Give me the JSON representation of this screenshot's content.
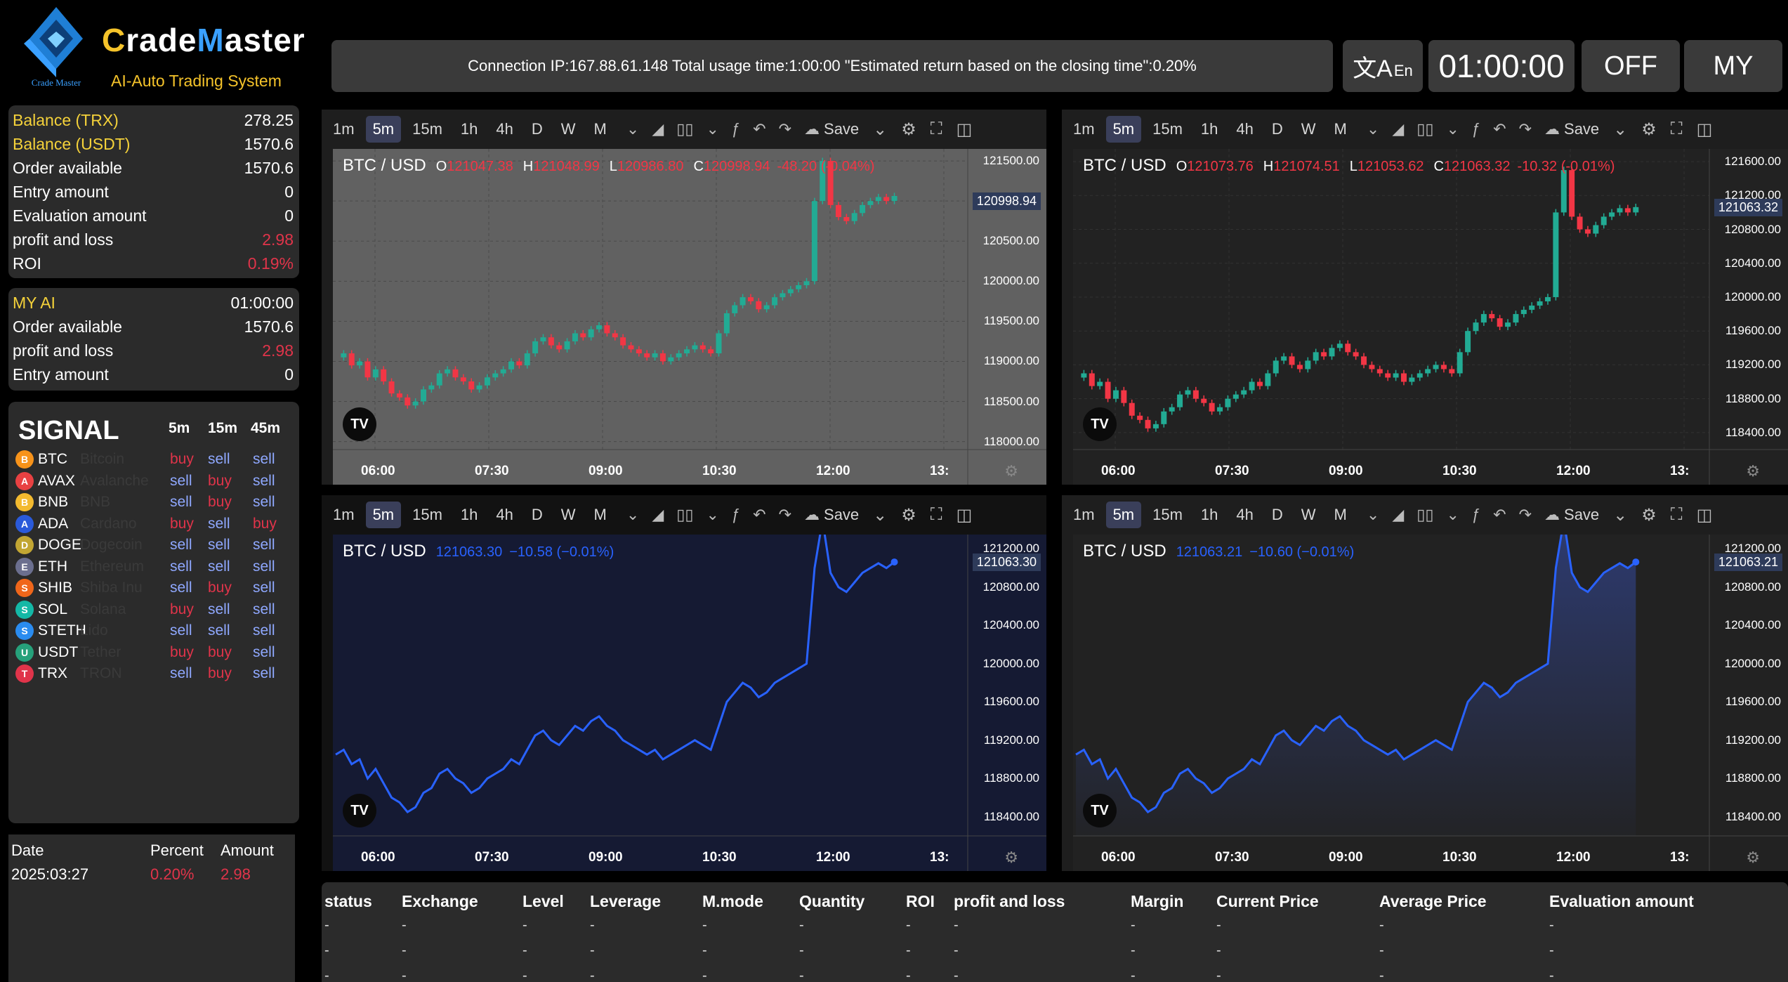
{
  "brand": {
    "part1": "C",
    "part2": "rade",
    "part3": "M",
    "part4": "aster",
    "tagline": "AI-Auto Trading System",
    "logo_caption": "Crade Master"
  },
  "account": {
    "rows": [
      {
        "label": "Balance (TRX)",
        "value": "278.25"
      },
      {
        "label": "Balance (USDT)",
        "value": "1570.6"
      },
      {
        "label": "Order available",
        "value": "1570.6"
      },
      {
        "label": "Entry amount",
        "value": "0"
      },
      {
        "label": "Evaluation amount",
        "value": "0"
      },
      {
        "label": "profit and loss",
        "value": "2.98"
      },
      {
        "label": "ROI",
        "value": "0.19%"
      }
    ]
  },
  "my_ai": {
    "rows": [
      {
        "label": "MY AI",
        "value": "01:00:00"
      },
      {
        "label": "Order available",
        "value": "1570.6"
      },
      {
        "label": "profit and loss",
        "value": "2.98"
      },
      {
        "label": "Entry amount",
        "value": "0"
      }
    ]
  },
  "signal": {
    "title": "SIGNAL",
    "headers": [
      "5m",
      "15m",
      "45m"
    ],
    "rows": [
      {
        "sym": "BTC",
        "name": "Bitcoin",
        "s5": "buy",
        "s15": "sell",
        "s45": "sell",
        "color": "#f7931a"
      },
      {
        "sym": "AVAX",
        "name": "Avalanche",
        "s5": "sell",
        "s15": "buy",
        "s45": "sell",
        "color": "#e84142"
      },
      {
        "sym": "BNB",
        "name": "BNB",
        "s5": "sell",
        "s15": "buy",
        "s45": "sell",
        "color": "#f3ba2f"
      },
      {
        "sym": "ADA",
        "name": "Cardano",
        "s5": "buy",
        "s15": "sell",
        "s45": "buy",
        "color": "#2a5ada"
      },
      {
        "sym": "DOGE",
        "name": "Dogecoin",
        "s5": "sell",
        "s15": "sell",
        "s45": "sell",
        "color": "#c2a633"
      },
      {
        "sym": "ETH",
        "name": "Ethereum",
        "s5": "sell",
        "s15": "sell",
        "s45": "sell",
        "color": "#6b6f8f"
      },
      {
        "sym": "SHIB",
        "name": "Shiba Inu",
        "s5": "sell",
        "s15": "buy",
        "s45": "sell",
        "color": "#f0661a"
      },
      {
        "sym": "SOL",
        "name": "Solana",
        "s5": "buy",
        "s15": "sell",
        "s45": "sell",
        "color": "#14b8a6"
      },
      {
        "sym": "STETH",
        "name": "Lido",
        "s5": "sell",
        "s15": "sell",
        "s45": "sell",
        "color": "#2a8cf0"
      },
      {
        "sym": "USDT",
        "name": "Tether",
        "s5": "buy",
        "s15": "buy",
        "s45": "sell",
        "color": "#26a17b"
      },
      {
        "sym": "TRX",
        "name": "TRON",
        "s5": "sell",
        "s15": "buy",
        "s45": "sell",
        "color": "#e0344a"
      }
    ]
  },
  "history": {
    "headers": [
      "Date",
      "Percent",
      "Amount"
    ],
    "rows": [
      {
        "date": "2025:03:27",
        "percent": "0.20%",
        "amount": "2.98"
      }
    ]
  },
  "topbar": {
    "info": "Connection IP:167.88.61.148 Total usage time:1:00:00 \"Estimated return based on the closing time\":0.20%",
    "lang": "En",
    "lang_icon": "文A",
    "timer": "01:00:00",
    "off": "OFF",
    "my": "MY"
  },
  "toolbar": {
    "timeframes": [
      "1m",
      "5m",
      "15m",
      "1h",
      "4h",
      "D",
      "W",
      "M"
    ],
    "save": "Save",
    "active_tf": "5m"
  },
  "charts": [
    {
      "id": "c1",
      "style": "candles",
      "bg": "#616161",
      "symbol": "BTC / USD",
      "o": "121047.38",
      "h": "121048.99",
      "l": "120986.80",
      "c": "120998.94",
      "chg": "-48.20 (-0.04%)",
      "last": "120998.94",
      "yticks": [
        "121500.00",
        "121000.00",
        "120500.00",
        "120000.00",
        "119500.00",
        "119000.00",
        "118500.00",
        "118000.00"
      ],
      "ymin": 117900,
      "ymax": 121650,
      "xticks": [
        "06:00",
        "07:30",
        "09:00",
        "10:30",
        "12:00",
        "13:"
      ]
    },
    {
      "id": "c2",
      "style": "candles",
      "bg": "#222222",
      "symbol": "BTC / USD",
      "o": "121073.76",
      "h": "121074.51",
      "l": "121053.62",
      "c": "121063.32",
      "chg": "-10.32 (-0.01%)",
      "last": "121063.32",
      "yticks": [
        "121600.00",
        "121200.00",
        "120800.00",
        "120400.00",
        "120000.00",
        "119600.00",
        "119200.00",
        "118800.00",
        "118400.00"
      ],
      "ymin": 118200,
      "ymax": 121750,
      "xticks": [
        "06:00",
        "07:30",
        "09:00",
        "10:30",
        "12:00",
        "13:"
      ]
    },
    {
      "id": "c3",
      "style": "line",
      "bg": "#151a33",
      "symbol": "BTC / USD",
      "val": "121063.30",
      "chg": "−10.58 (−0.01%)",
      "last": "121063.30",
      "yticks": [
        "121200.00",
        "120800.00",
        "120400.00",
        "120000.00",
        "119600.00",
        "119200.00",
        "118800.00",
        "118400.00"
      ],
      "ymin": 118200,
      "ymax": 121350,
      "xticks": [
        "06:00",
        "07:30",
        "09:00",
        "10:30",
        "12:00",
        "13:"
      ]
    },
    {
      "id": "c4",
      "style": "area",
      "bg": "#222222",
      "symbol": "BTC / USD",
      "val": "121063.21",
      "chg": "−10.60 (−0.01%)",
      "last": "121063.21",
      "yticks": [
        "121200.00",
        "120800.00",
        "120400.00",
        "120000.00",
        "119600.00",
        "119200.00",
        "118800.00",
        "118400.00"
      ],
      "ymin": 118200,
      "ymax": 121350,
      "xticks": [
        "06:00",
        "07:30",
        "09:00",
        "10:30",
        "12:00",
        "13:"
      ]
    }
  ],
  "series": [
    119050,
    119100,
    118950,
    119000,
    118800,
    118900,
    118750,
    118600,
    118550,
    118450,
    118500,
    118650,
    118700,
    118850,
    118900,
    118800,
    118750,
    118650,
    118700,
    118800,
    118850,
    118900,
    119000,
    118950,
    119100,
    119250,
    119300,
    119200,
    119150,
    119250,
    119350,
    119300,
    119400,
    119450,
    119350,
    119300,
    119200,
    119150,
    119100,
    119050,
    119100,
    119000,
    119050,
    119100,
    119150,
    119200,
    119150,
    119100,
    119350,
    119600,
    119700,
    119800,
    119750,
    119650,
    119700,
    119800,
    119850,
    119900,
    119950,
    120000,
    121000,
    121500,
    120950,
    120800,
    120750,
    120850,
    120950,
    121000,
    121050,
    121000,
    121063
  ],
  "table": {
    "headers": [
      "status",
      "Exchange",
      "Level",
      "Leverage",
      "M.mode",
      "Quantity",
      "ROI",
      "profit and loss",
      "Margin",
      "Current Price",
      "Average Price",
      "Evaluation amount"
    ],
    "rows": [
      [
        "-",
        "-",
        "-",
        "-",
        "-",
        "-",
        "-",
        "-",
        "-",
        "-",
        "-",
        "-"
      ],
      [
        "-",
        "-",
        "-",
        "-",
        "-",
        "-",
        "-",
        "-",
        "-",
        "-",
        "-",
        "-"
      ],
      [
        "-",
        "-",
        "-",
        "-",
        "-",
        "-",
        "-",
        "-",
        "-",
        "-",
        "-",
        "-"
      ]
    ]
  }
}
